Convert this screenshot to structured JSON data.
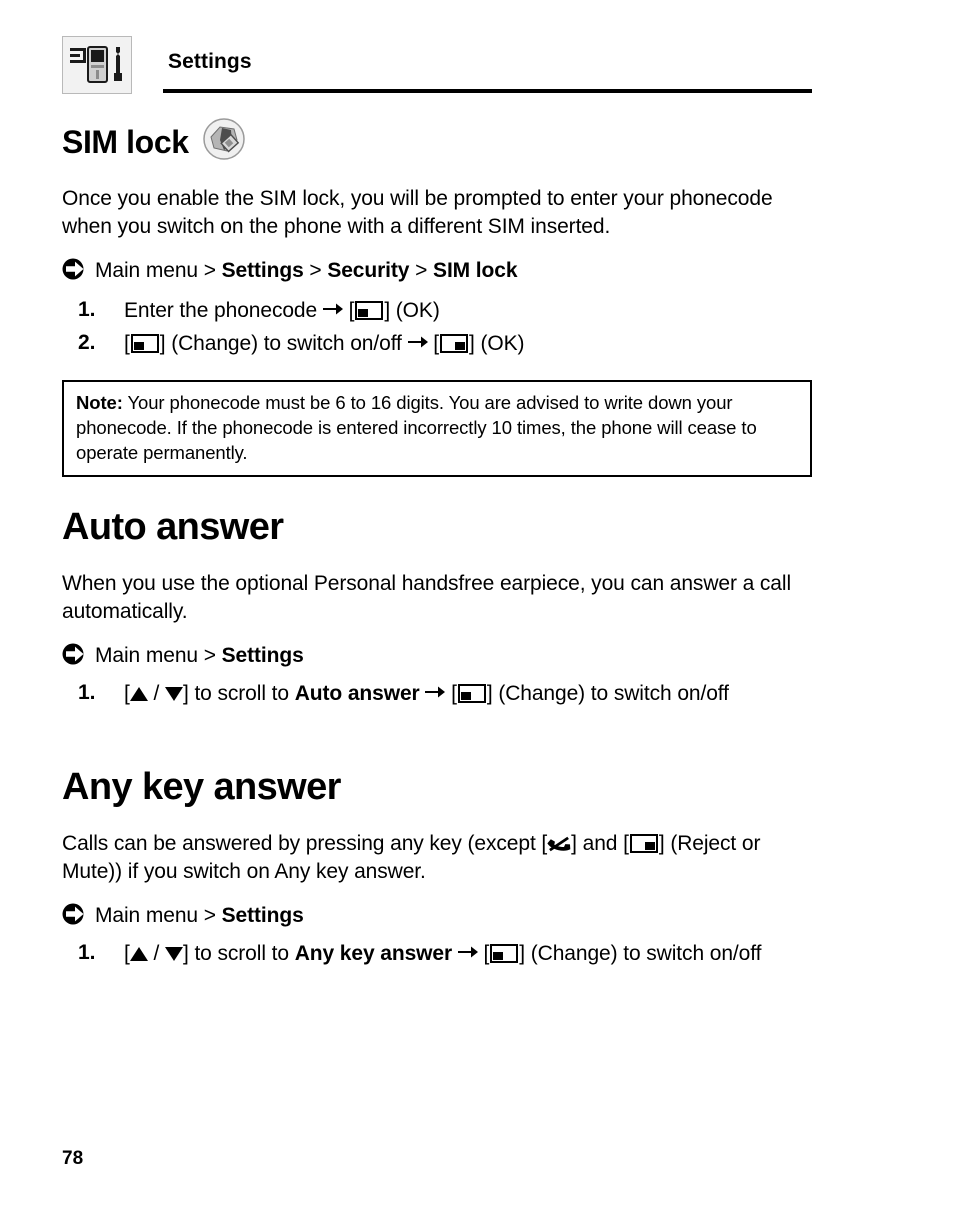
{
  "header": {
    "title": "Settings",
    "icon": "settings-phone-wrench-icon"
  },
  "sections": [
    {
      "id": "sim-lock",
      "heading": "SIM lock",
      "heading_icon": "sim-lock-icon",
      "intro": "Once you enable the SIM lock, you will be prompted to enter your phonecode when you switch on the phone with a different SIM inserted.",
      "menu_path": {
        "prefix": "Main menu",
        "sep": " > ",
        "items": [
          "Settings",
          "Security",
          "SIM lock"
        ]
      },
      "steps": [
        {
          "num": "1.",
          "parts": [
            {
              "t": "text",
              "v": "Enter the phonecode "
            },
            {
              "t": "arrow"
            },
            {
              "t": "text",
              "v": " ["
            },
            {
              "t": "key",
              "v": "left"
            },
            {
              "t": "text",
              "v": "] (OK)"
            }
          ]
        },
        {
          "num": "2.",
          "parts": [
            {
              "t": "text",
              "v": "["
            },
            {
              "t": "key",
              "v": "left"
            },
            {
              "t": "text",
              "v": "] (Change) to switch on/off "
            },
            {
              "t": "arrow"
            },
            {
              "t": "text",
              "v": " ["
            },
            {
              "t": "key",
              "v": "right"
            },
            {
              "t": "text",
              "v": "] (OK)"
            }
          ]
        }
      ]
    },
    {
      "id": "auto-answer",
      "heading": "Auto answer",
      "intro": "When you use the optional Personal handsfree earpiece, you can answer a call automatically.",
      "menu_path": {
        "prefix": "Main menu",
        "sep": " > ",
        "items": [
          "Settings"
        ]
      },
      "steps": [
        {
          "num": "1.",
          "parts": [
            {
              "t": "text",
              "v": "["
            },
            {
              "t": "tri",
              "v": "up"
            },
            {
              "t": "text",
              "v": " / "
            },
            {
              "t": "tri",
              "v": "down"
            },
            {
              "t": "text",
              "v": "] to scroll to "
            },
            {
              "t": "bold",
              "v": "Auto answer"
            },
            {
              "t": "text",
              "v": " "
            },
            {
              "t": "arrow"
            },
            {
              "t": "text",
              "v": " ["
            },
            {
              "t": "key",
              "v": "left"
            },
            {
              "t": "text",
              "v": "] (Change) to switch on/off"
            }
          ]
        }
      ]
    },
    {
      "id": "any-key-answer",
      "heading": "Any key answer",
      "intro_parts": [
        {
          "t": "text",
          "v": "Calls can be answered by pressing any key (except ["
        },
        {
          "t": "reject"
        },
        {
          "t": "text",
          "v": "] and ["
        },
        {
          "t": "key",
          "v": "right"
        },
        {
          "t": "text",
          "v": "] (Reject or Mute)) if you switch on Any key answer."
        }
      ],
      "intro": "Calls can be answered by pressing any key (except [reject-key] and [right-soft-key] (Reject or Mute)) if you switch on Any key answer.",
      "menu_path": {
        "prefix": "Main menu",
        "sep": " > ",
        "items": [
          "Settings"
        ]
      },
      "steps": [
        {
          "num": "1.",
          "parts": [
            {
              "t": "text",
              "v": "["
            },
            {
              "t": "tri",
              "v": "up"
            },
            {
              "t": "text",
              "v": " / "
            },
            {
              "t": "tri",
              "v": "down"
            },
            {
              "t": "text",
              "v": "] to scroll to "
            },
            {
              "t": "bold",
              "v": "Any key answer"
            },
            {
              "t": "text",
              "v": " "
            },
            {
              "t": "arrow"
            },
            {
              "t": "text",
              "v": " ["
            },
            {
              "t": "key",
              "v": "left"
            },
            {
              "t": "text",
              "v": "] (Change) to switch on/off"
            }
          ]
        }
      ]
    }
  ],
  "note": {
    "label": "Note:",
    "text": " Your phonecode must be 6 to 16 digits. You are advised to write down your phonecode. If the phonecode is entered incorrectly 10 times, the phone will cease to operate permanently."
  },
  "page_number": "78",
  "colors": {
    "text": "#000000",
    "background": "#ffffff",
    "icon_frame": "#b9b9b9",
    "icon_fill": "#f2f2f2"
  }
}
